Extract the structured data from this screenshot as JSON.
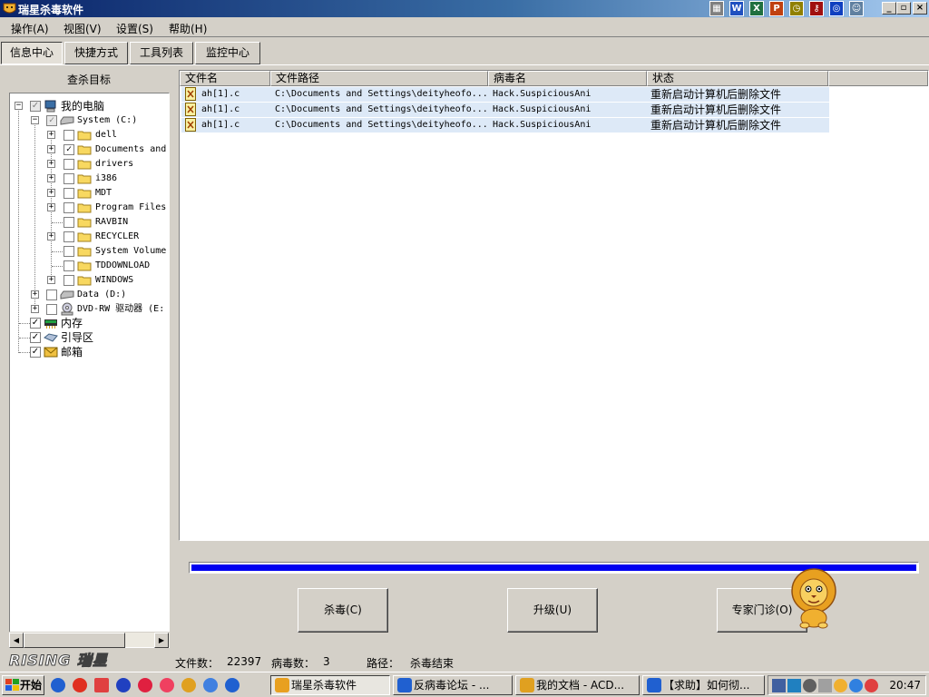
{
  "window": {
    "title": "瑞星杀毒软件"
  },
  "menu": [
    "操作(A)",
    "视图(V)",
    "设置(S)",
    "帮助(H)"
  ],
  "tabs": [
    "信息中心",
    "快捷方式",
    "工具列表",
    "监控中心"
  ],
  "tree": {
    "header": "查杀目标",
    "root": "我的电脑",
    "drive_c": "System (C:)",
    "folders": [
      "dell",
      "Documents and",
      "drivers",
      "i386",
      "MDT",
      "Program Files",
      "RAVBIN",
      "RECYCLER",
      "System Volume",
      "TDDOWNLOAD",
      "WINDOWS"
    ],
    "drive_d": "Data (D:)",
    "drive_e": "DVD-RW 驱动器 (E:",
    "memory": "内存",
    "boot": "引导区",
    "mail": "邮箱"
  },
  "list": {
    "columns": [
      "文件名",
      "文件路径",
      "病毒名",
      "状态"
    ],
    "rows": [
      {
        "file": "ah[1].c",
        "path": "C:\\Documents and Settings\\deityheofo...",
        "virus": "Hack.SuspiciousAni",
        "status": "重新启动计算机后删除文件"
      },
      {
        "file": "ah[1].c",
        "path": "C:\\Documents and Settings\\deityheofo...",
        "virus": "Hack.SuspiciousAni",
        "status": "重新启动计算机后删除文件"
      },
      {
        "file": "ah[1].c",
        "path": "C:\\Documents and Settings\\deityheofo...",
        "virus": "Hack.SuspiciousAni",
        "status": "重新启动计算机后删除文件"
      }
    ]
  },
  "progress": {
    "fraction": 1.0
  },
  "buttons": {
    "kill": "杀毒(C)",
    "upgrade": "升级(U)",
    "expert": "专家门诊(O)"
  },
  "logo": "RISING 瑞星",
  "status": {
    "files_label": "文件数：",
    "files_value": "22397",
    "virus_label": "病毒数：",
    "virus_value": "3",
    "path_label": "路径：",
    "path_value": "杀毒结束"
  },
  "taskbar": {
    "start": "开始",
    "items": [
      "瑞星杀毒软件",
      "反病毒论坛 - ...",
      "我的文档 - ACD...",
      "【求助】如何彻..."
    ],
    "clock": "20:47"
  },
  "colors": {
    "title_from": "#0a246a",
    "title_to": "#a6caf0",
    "progress": "#0000f0",
    "row_highlight": "#dde9f7"
  }
}
